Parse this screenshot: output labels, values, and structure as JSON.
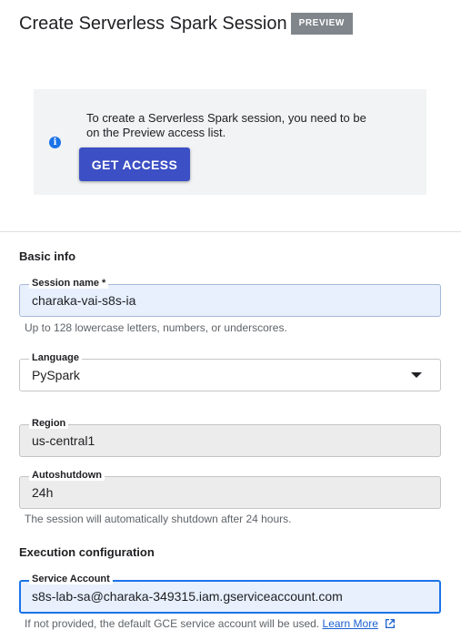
{
  "header": {
    "title": "Create Serverless Spark Session",
    "badge": "PREVIEW"
  },
  "banner": {
    "text": "To create a Serverless Spark session, you need to be on the Preview access list.",
    "button_label": "GET ACCESS",
    "icon": "info-icon"
  },
  "basic_info": {
    "section_title": "Basic info",
    "session_name": {
      "label": "Session name *",
      "value": "charaka-vai-s8s-ia",
      "hint": "Up to 128 lowercase letters, numbers, or underscores."
    },
    "language": {
      "label": "Language",
      "value": "PySpark"
    },
    "region": {
      "label": "Region",
      "value": "us-central1"
    },
    "autoshutdown": {
      "label": "Autoshutdown",
      "value": "24h",
      "hint": "The session will automatically shutdown after 24 hours."
    }
  },
  "execution": {
    "section_title": "Execution configuration",
    "service_account": {
      "label": "Service Account",
      "value": "s8s-lab-sa@charaka-349315.iam.gserviceaccount.com",
      "hint": "If not provided, the default GCE service account will be used.",
      "link_text": "Learn More"
    }
  },
  "colors": {
    "accent": "#1a73e8",
    "button": "#3c4fc4",
    "badge": "#80868b"
  }
}
